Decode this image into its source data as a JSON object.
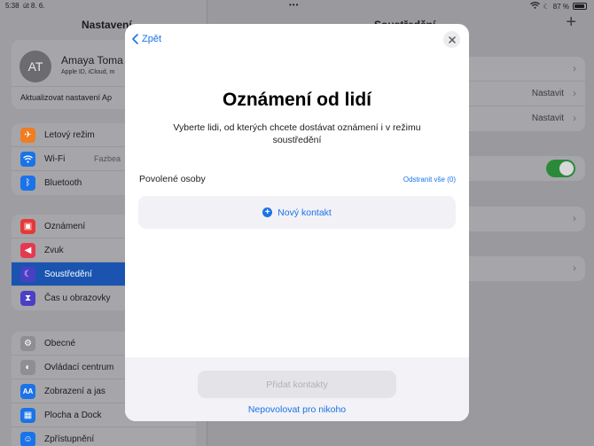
{
  "status_bar": {
    "time": "5:38",
    "date": "út 8. 6.",
    "battery": "87 %"
  },
  "settings": {
    "title": "Nastavení",
    "profile": {
      "initials": "AT",
      "name": "Amaya Toma",
      "subtitle": "Apple ID, iCloud, m",
      "update_text": "Aktualizovat nastavení Ap"
    },
    "group1": [
      {
        "label": "Letový režim",
        "icon": "airplane-icon",
        "color": "#ef7d22"
      },
      {
        "label": "Wi-Fi",
        "value": "Fazbea",
        "icon": "wifi-icon",
        "color": "#1a73e8"
      },
      {
        "label": "Bluetooth",
        "icon": "bluetooth-icon",
        "color": "#1a73e8"
      }
    ],
    "group2": [
      {
        "label": "Oznámení",
        "icon": "notifications-icon",
        "color": "#e53935"
      },
      {
        "label": "Zvuk",
        "icon": "sound-icon",
        "color": "#e53950"
      },
      {
        "label": "Soustředění",
        "icon": "moon-icon",
        "color": "#4b3fc4",
        "selected": true
      },
      {
        "label": "Čas u obrazovky",
        "icon": "hourglass-icon",
        "color": "#4b3fc4"
      }
    ],
    "group3": [
      {
        "label": "Obecné",
        "icon": "gear-icon",
        "color": "#8e8e93"
      },
      {
        "label": "Ovládací centrum",
        "icon": "control-center-icon",
        "color": "#8e8e93"
      },
      {
        "label": "Zobrazení a jas",
        "icon": "display-icon",
        "color": "#1a73e8"
      },
      {
        "label": "Plocha a Dock",
        "icon": "home-screen-icon",
        "color": "#1a73e8"
      },
      {
        "label": "Zpřístupnění",
        "icon": "accessibility-icon",
        "color": "#1a73e8"
      }
    ]
  },
  "focus": {
    "title": "Soustředění",
    "rows": [
      {
        "value": "Nastavit"
      },
      {
        "value": "Nastavit"
      }
    ],
    "toggle_on": true
  },
  "modal": {
    "back_label": "Zpět",
    "title": "Oznámení od lidí",
    "description": "Vyberte lidi, od kterých chcete dostávat oznámení i v režimu soustředění",
    "section_label": "Povolené osoby",
    "remove_all_label": "Odstranit vše (0)",
    "new_contact_label": "Nový kontakt",
    "add_contacts_label": "Přidat kontakty",
    "deny_label": "Nepovolovat pro nikoho"
  }
}
